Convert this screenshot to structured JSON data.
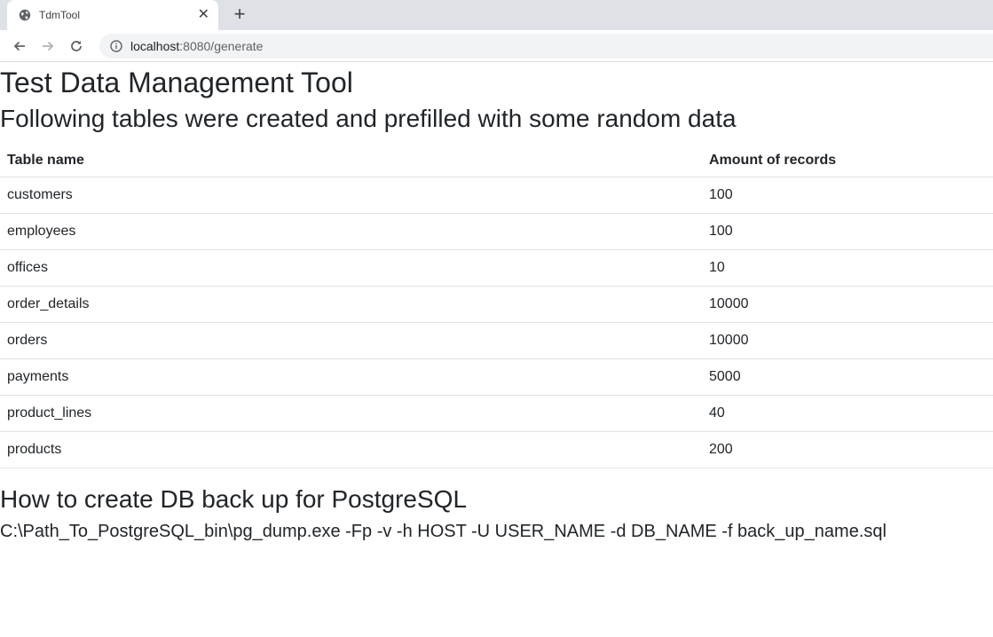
{
  "browser": {
    "tab_title": "TdmTool",
    "url_host": "localhost",
    "url_path": ":8080/generate"
  },
  "page": {
    "title": "Test Data Management Tool",
    "subtitle": "Following tables were created and prefilled with some random data",
    "table": {
      "headers": [
        "Table name",
        "Amount of records"
      ],
      "rows": [
        [
          "customers",
          "100"
        ],
        [
          "employees",
          "100"
        ],
        [
          "offices",
          "10"
        ],
        [
          "order_details",
          "10000"
        ],
        [
          "orders",
          "10000"
        ],
        [
          "payments",
          "5000"
        ],
        [
          "product_lines",
          "40"
        ],
        [
          "products",
          "200"
        ]
      ]
    },
    "backup_heading": "How to create DB back up for PostgreSQL",
    "backup_command": "C:\\Path_To_PostgreSQL_bin\\pg_dump.exe -Fp -v -h HOST -U USER_NAME -d DB_NAME -f back_up_name.sql"
  }
}
